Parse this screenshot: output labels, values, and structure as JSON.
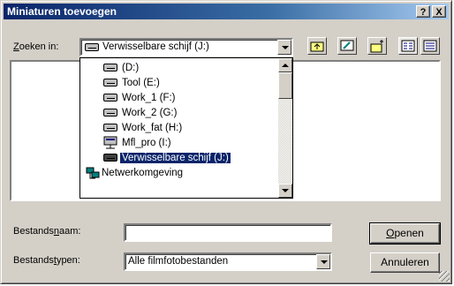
{
  "dialog": {
    "title": "Miniaturen toevoegen",
    "help_label": "?",
    "close_label": "X"
  },
  "look_in": {
    "label_prefix": "Z",
    "label_rest": "oeken in:",
    "value": "Verwisselbare schijf (J:)"
  },
  "toolbar": {
    "icons": [
      "up-folder-icon",
      "desktop-icon",
      "new-folder-icon",
      "list-view-icon",
      "details-view-icon"
    ]
  },
  "dropdown": {
    "items": [
      {
        "label": "(D:)",
        "icon": "drive-icon"
      },
      {
        "label": "Tool (E:)",
        "icon": "drive-icon"
      },
      {
        "label": "Work_1 (F:)",
        "icon": "drive-icon"
      },
      {
        "label": "Work_2 (G:)",
        "icon": "drive-icon"
      },
      {
        "label": "Work_fat (H:)",
        "icon": "drive-icon"
      },
      {
        "label": "Mfl_pro (I:)",
        "icon": "network-drive-icon"
      },
      {
        "label": "Verwisselbare schijf (J:)",
        "icon": "removable-drive-icon",
        "selected": true
      },
      {
        "label": "Netwerkomgeving",
        "icon": "network-neighborhood-icon"
      }
    ]
  },
  "filename": {
    "label_a": "Bestands",
    "label_u": "n",
    "label_b": "aam:",
    "value": ""
  },
  "filetype": {
    "label_a": "Bestands",
    "label_u": "t",
    "label_b": "ypen:",
    "value": "Alle filmfotobestanden"
  },
  "buttons": {
    "open_u": "O",
    "open_rest": "penen",
    "cancel": "Annuleren"
  },
  "colors": {
    "title_start": "#0a246a",
    "title_end": "#a6caf0",
    "face": "#d4d0c8",
    "selection": "#0a246a"
  }
}
